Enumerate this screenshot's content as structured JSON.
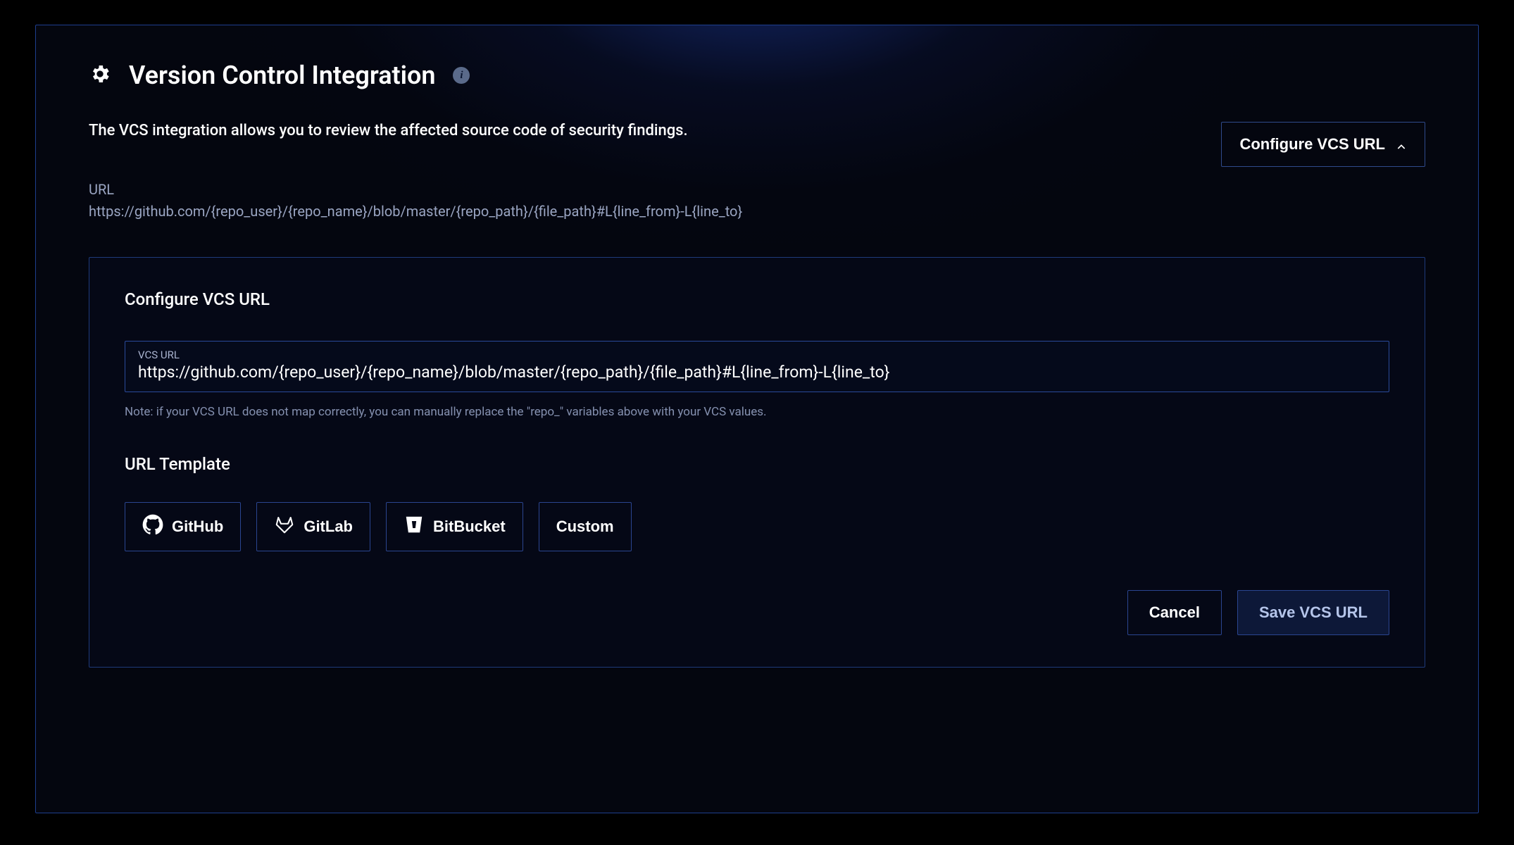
{
  "header": {
    "title": "Version Control Integration",
    "info_tooltip": "i"
  },
  "description": "The VCS integration allows you to review the affected source code of security findings.",
  "configure_button": "Configure VCS URL",
  "url_display": {
    "label": "URL",
    "value": "https://github.com/{repo_user}/{repo_name}/blob/master/{repo_path}/{file_path}#L{line_from}-L{line_to}"
  },
  "config_card": {
    "title": "Configure VCS URL",
    "input_label": "VCS URL",
    "input_value": "https://github.com/{repo_user}/{repo_name}/blob/master/{repo_path}/{file_path}#L{line_from}-L{line_to}",
    "note": "Note: if your VCS URL does not map correctly, you can manually replace the \"repo_\" variables above with your VCS values.",
    "template_title": "URL Template",
    "templates": {
      "github": "GitHub",
      "gitlab": "GitLab",
      "bitbucket": "BitBucket",
      "custom": "Custom"
    },
    "actions": {
      "cancel": "Cancel",
      "save": "Save VCS URL"
    }
  }
}
